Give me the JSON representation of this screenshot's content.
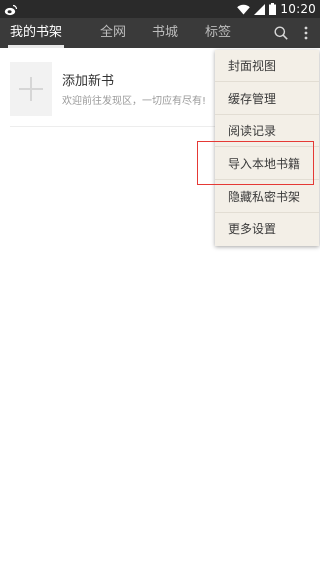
{
  "status_bar": {
    "time": "10:20",
    "icons": [
      "weibo-icon",
      "wifi-icon",
      "signal-icon",
      "battery-icon"
    ]
  },
  "tabs": [
    {
      "label": "我的书架",
      "active": true
    },
    {
      "label": "全网",
      "active": false
    },
    {
      "label": "书城",
      "active": false
    },
    {
      "label": "标签",
      "active": false
    }
  ],
  "toolbar_icons": [
    "search-icon",
    "more-vert-icon"
  ],
  "bookshelf": {
    "add_title": "添加新书",
    "add_subtitle": "欢迎前往发现区，一切应有尽有!"
  },
  "menu": {
    "items": [
      {
        "label": "封面视图"
      },
      {
        "label": "缓存管理"
      },
      {
        "label": "阅读记录"
      },
      {
        "label": "导入本地书籍"
      },
      {
        "label": "隐藏私密书架"
      },
      {
        "label": "更多设置"
      }
    ]
  },
  "colors": {
    "status_bar": "#2a2a2a",
    "top_bar": "#3a3a3a",
    "menu_bg": "#f3efe7",
    "highlight": "#e53935"
  }
}
